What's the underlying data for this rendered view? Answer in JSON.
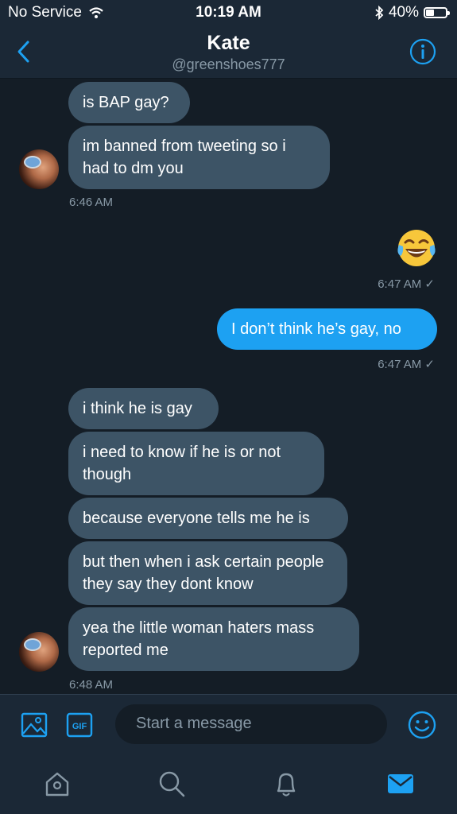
{
  "status_bar": {
    "carrier": "No Service",
    "time": "10:19 AM",
    "battery": "40%",
    "battery_level": 0.4
  },
  "header": {
    "name": "Kate",
    "handle": "@greenshoes777"
  },
  "messages": [
    {
      "text": "is BAP gay?"
    },
    {
      "text": "im banned from tweeting so i had to dm you"
    },
    {
      "timestamp": "6:46 AM"
    },
    {
      "emoji": "face-with-tears-of-joy",
      "timestamp": "6:47 AM ✓"
    },
    {
      "text": "I don’t think he’s gay, no",
      "timestamp": "6:47 AM ✓"
    },
    {
      "text": "i think he is gay"
    },
    {
      "text": "i need to know if he is or not though"
    },
    {
      "text": "because everyone tells me he is"
    },
    {
      "text": "but then when i ask certain people they say they dont know"
    },
    {
      "text": "yea the little woman haters mass reported me"
    },
    {
      "timestamp": "6:48 AM"
    }
  ],
  "compose": {
    "placeholder": "Start a message",
    "gif_label": "GIF"
  },
  "colors": {
    "background": "#141d26",
    "bar": "#1b2836",
    "accent": "#1da1f2",
    "incoming_bubble": "#3d5466",
    "muted": "#8899a6"
  },
  "icons": [
    "wifi-icon",
    "bluetooth-icon",
    "battery-icon",
    "back-chevron-icon",
    "info-icon",
    "image-icon",
    "gif-icon",
    "emoji-icon",
    "home-icon",
    "search-icon",
    "notifications-icon",
    "messages-icon"
  ]
}
